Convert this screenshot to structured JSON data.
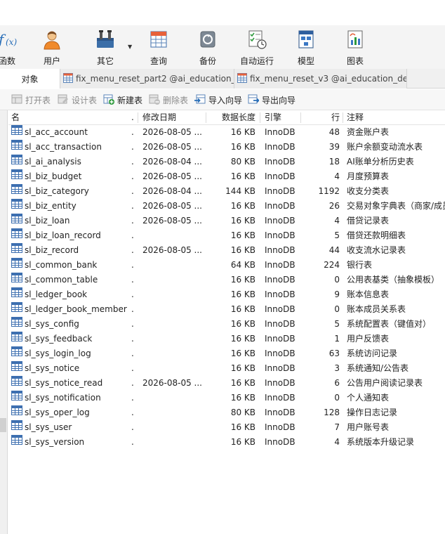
{
  "toolbar": {
    "items": [
      {
        "key": "function",
        "label": "函数",
        "icon": "function-icon"
      },
      {
        "key": "user",
        "label": "用户",
        "icon": "user-icon"
      },
      {
        "key": "other",
        "label": "其它",
        "icon": "tools-icon"
      },
      {
        "key": "query",
        "label": "查询",
        "icon": "query-grid-icon"
      },
      {
        "key": "backup",
        "label": "备份",
        "icon": "backup-icon"
      },
      {
        "key": "automation",
        "label": "自动运行",
        "icon": "schedule-icon"
      },
      {
        "key": "model",
        "label": "模型",
        "icon": "model-icon"
      },
      {
        "key": "chart",
        "label": "图表",
        "icon": "chart-icon"
      }
    ]
  },
  "tabs": {
    "objects": "对象",
    "tab1": "fix_menu_reset_part2 @ai_education_...",
    "tab2": "fix_menu_reset_v3 @ai_education_de..."
  },
  "actions": {
    "open": "打开表",
    "design": "设计表",
    "new": "新建表",
    "delete": "删除表",
    "import": "导入向导",
    "export": "导出向导"
  },
  "columns": {
    "name": "名",
    "modified": "修改日期",
    "size": "数据长度",
    "engine": "引擎",
    "rows": "行",
    "comment": "注释"
  },
  "rows": [
    {
      "name": "sl_acc_account",
      "dot": ".",
      "modified": "2026-08-05 ...",
      "size": "16 KB",
      "engine": "InnoDB",
      "rows": "48",
      "comment": "资金账户表"
    },
    {
      "name": "sl_acc_transaction",
      "dot": ".",
      "modified": "2026-08-05 ...",
      "size": "16 KB",
      "engine": "InnoDB",
      "rows": "39",
      "comment": "账户余额变动流水表"
    },
    {
      "name": "sl_ai_analysis",
      "dot": ".",
      "modified": "2026-08-04 ...",
      "size": "80 KB",
      "engine": "InnoDB",
      "rows": "18",
      "comment": "AI账单分析历史表"
    },
    {
      "name": "sl_biz_budget",
      "dot": ".",
      "modified": "2026-08-05 ...",
      "size": "16 KB",
      "engine": "InnoDB",
      "rows": "4",
      "comment": "月度预算表"
    },
    {
      "name": "sl_biz_category",
      "dot": ".",
      "modified": "2026-08-04 ...",
      "size": "144 KB",
      "engine": "InnoDB",
      "rows": "1192",
      "comment": "收支分类表"
    },
    {
      "name": "sl_biz_entity",
      "dot": ".",
      "modified": "2026-08-05 ...",
      "size": "16 KB",
      "engine": "InnoDB",
      "rows": "26",
      "comment": "交易对象字典表（商家/成员"
    },
    {
      "name": "sl_biz_loan",
      "dot": ".",
      "modified": "2026-08-05 ...",
      "size": "16 KB",
      "engine": "InnoDB",
      "rows": "4",
      "comment": "借贷记录表"
    },
    {
      "name": "sl_biz_loan_record",
      "dot": ".",
      "modified": "",
      "size": "16 KB",
      "engine": "InnoDB",
      "rows": "5",
      "comment": "借贷还款明细表"
    },
    {
      "name": "sl_biz_record",
      "dot": ".",
      "modified": "2026-08-05 ...",
      "size": "16 KB",
      "engine": "InnoDB",
      "rows": "44",
      "comment": "收支流水记录表"
    },
    {
      "name": "sl_common_bank",
      "dot": ".",
      "modified": "",
      "size": "64 KB",
      "engine": "InnoDB",
      "rows": "224",
      "comment": "银行表"
    },
    {
      "name": "sl_common_table",
      "dot": ".",
      "modified": "",
      "size": "16 KB",
      "engine": "InnoDB",
      "rows": "0",
      "comment": "公用表基类（抽象模板）"
    },
    {
      "name": "sl_ledger_book",
      "dot": ".",
      "modified": "",
      "size": "16 KB",
      "engine": "InnoDB",
      "rows": "9",
      "comment": "账本信息表"
    },
    {
      "name": "sl_ledger_book_member",
      "dot": ".",
      "modified": "",
      "size": "16 KB",
      "engine": "InnoDB",
      "rows": "0",
      "comment": "账本成员关系表"
    },
    {
      "name": "sl_sys_config",
      "dot": ".",
      "modified": "",
      "size": "16 KB",
      "engine": "InnoDB",
      "rows": "5",
      "comment": "系统配置表（键值对）"
    },
    {
      "name": "sl_sys_feedback",
      "dot": ".",
      "modified": "",
      "size": "16 KB",
      "engine": "InnoDB",
      "rows": "1",
      "comment": "用户反馈表"
    },
    {
      "name": "sl_sys_login_log",
      "dot": ".",
      "modified": "",
      "size": "16 KB",
      "engine": "InnoDB",
      "rows": "63",
      "comment": "系统访问记录"
    },
    {
      "name": "sl_sys_notice",
      "dot": ".",
      "modified": "",
      "size": "16 KB",
      "engine": "InnoDB",
      "rows": "3",
      "comment": "系统通知/公告表"
    },
    {
      "name": "sl_sys_notice_read",
      "dot": ".",
      "modified": "2026-08-05 ...",
      "size": "16 KB",
      "engine": "InnoDB",
      "rows": "6",
      "comment": "公告用户阅读记录表"
    },
    {
      "name": "sl_sys_notification",
      "dot": ".",
      "modified": "",
      "size": "16 KB",
      "engine": "InnoDB",
      "rows": "0",
      "comment": "个人通知表"
    },
    {
      "name": "sl_sys_oper_log",
      "dot": ".",
      "modified": "",
      "size": "80 KB",
      "engine": "InnoDB",
      "rows": "128",
      "comment": "操作日志记录"
    },
    {
      "name": "sl_sys_user",
      "dot": ".",
      "modified": "",
      "size": "16 KB",
      "engine": "InnoDB",
      "rows": "7",
      "comment": "用户账号表"
    },
    {
      "name": "sl_sys_version",
      "dot": ".",
      "modified": "",
      "size": "16 KB",
      "engine": "InnoDB",
      "rows": "4",
      "comment": "系统版本升级记录"
    }
  ]
}
